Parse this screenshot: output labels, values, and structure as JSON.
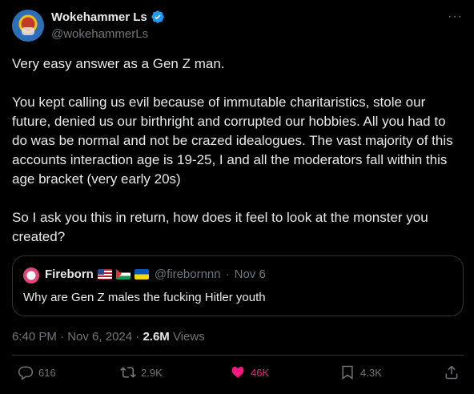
{
  "author": {
    "display_name": "Wokehammer Ls",
    "handle": "@wokehammerLs",
    "verified_icon": "verified-badge-icon",
    "more_label": "···"
  },
  "tweet": {
    "text": "Very easy answer as a Gen Z man.\n\nYou kept calling us evil because of immutable charitaristics, stole our future, denied us our birthright and corrupted our hobbies. All you had to do was be normal and not be crazed idealogues. The vast majority of this accounts interaction age is 19-25, I and all the moderators fall within this age bracket (very early 20s)\n\nSo I ask you this in return, how does it feel to look at the monster you created?"
  },
  "quote": {
    "name": "Fireborn",
    "flags": [
      "us-flag",
      "palestine-flag",
      "ukraine-flag"
    ],
    "handle": "@firebornnn",
    "separator": "·",
    "date": "Nov 6",
    "text": "Why are Gen Z males the fucking Hitler youth"
  },
  "meta": {
    "time": "6:40 PM",
    "separator": "·",
    "date": "Nov 6, 2024",
    "separator2": "·",
    "views_count": "2.6M",
    "views_label": "Views"
  },
  "actions": {
    "replies": "616",
    "reposts": "2.9K",
    "likes": "46K",
    "bookmarks": "4.3K"
  },
  "colors": {
    "background": "#000000",
    "text": "#e7e9ea",
    "muted": "#71767b",
    "border": "#2f3336",
    "like": "#f91880",
    "verified": "#1d9bf0"
  }
}
